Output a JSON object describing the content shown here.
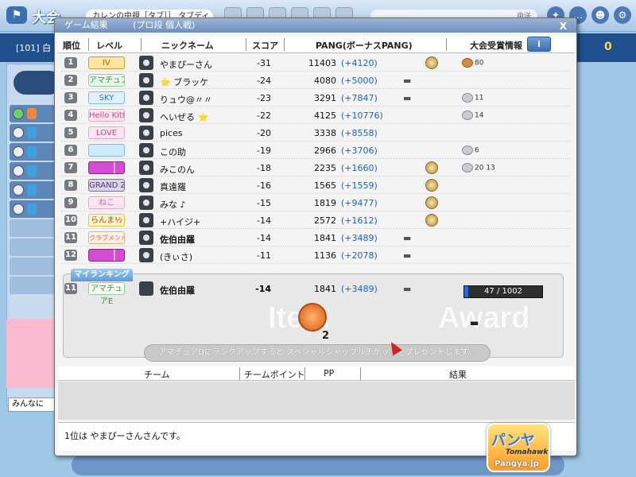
{
  "background": {
    "title": "大会",
    "room_name": "カレンの中視［タブ］］ タブディ",
    "send_label": "申送",
    "room_number": "[101] 白",
    "score": "0",
    "chat_input": "みんなに"
  },
  "dialog": {
    "title": "ゲーム結果",
    "subtitle": "(プロ段 個人戦)",
    "close": "X",
    "headers": {
      "rank": "順位",
      "level": "レベル",
      "nickname": "ニックネーム",
      "score": "スコア",
      "pang": "PANG(ボーナスPANG)",
      "tournament_info": "大会受賞情報",
      "info_button": "i"
    },
    "rows": [
      {
        "rank": "1",
        "level": "IV",
        "level_style": "pro",
        "name": "やまぴーさん",
        "score": "-31",
        "pang": "11403",
        "bonus": "(+4120)",
        "dash": "",
        "medal": true,
        "award": "80",
        "award_style": "cu",
        "bold": false
      },
      {
        "rank": "2",
        "level": "アマチュアA",
        "level_style": "am",
        "name": "⭐ ブラッケ",
        "score": "-24",
        "pang": "4080",
        "bonus": "(+5000)",
        "dash": "▬",
        "medal": false,
        "award": "",
        "award_style": "",
        "bold": false
      },
      {
        "rank": "3",
        "level": "SKY",
        "level_style": "wing",
        "name": "りュウ@〃〃",
        "score": "-23",
        "pang": "3291",
        "bonus": "(+7847)",
        "dash": "▬",
        "medal": false,
        "award": "11",
        "award_style": "",
        "bold": false
      },
      {
        "rank": "4",
        "level": "Hello Kitty",
        "level_style": "pink",
        "name": "へいぜる ⭐",
        "score": "-22",
        "pang": "4125",
        "bonus": "(+10776)",
        "dash": "",
        "medal": false,
        "award": "14",
        "award_style": "",
        "bold": false
      },
      {
        "rank": "5",
        "level": "LOVE",
        "level_style": "pink",
        "name": "pices",
        "score": "-20",
        "pang": "3338",
        "bonus": "(+8558)",
        "dash": "",
        "medal": false,
        "award": "",
        "award_style": "",
        "bold": false
      },
      {
        "rank": "6",
        "level": "",
        "level_style": "sky",
        "name": "この助",
        "score": "-19",
        "pang": "2966",
        "bonus": "(+3706)",
        "dash": "",
        "medal": false,
        "award": "6",
        "award_style": "",
        "bold": false
      },
      {
        "rank": "7",
        "level": "",
        "level_style": "bar",
        "name": "みこのん",
        "score": "-18",
        "pang": "2235",
        "bonus": "(+1660)",
        "dash": "",
        "medal": true,
        "award": "20 13",
        "award_style": "",
        "bold": false
      },
      {
        "rank": "8",
        "level": "GRAND ZODIAC",
        "level_style": "grand",
        "name": "真遠羅",
        "score": "-16",
        "pang": "1565",
        "bonus": "(+1559)",
        "dash": "",
        "medal": true,
        "award": "",
        "award_style": "",
        "bold": false
      },
      {
        "rank": "9",
        "level": "ねこ",
        "level_style": "neko",
        "name": "みな ♪",
        "score": "-15",
        "pang": "1819",
        "bonus": "(+9477)",
        "dash": "",
        "medal": true,
        "award": "",
        "award_style": "",
        "bold": false
      },
      {
        "rank": "10",
        "level": "らんま½",
        "level_style": "rin",
        "name": "+ハイジ+",
        "score": "-14",
        "pang": "2572",
        "bonus": "(+1612)",
        "dash": "",
        "medal": true,
        "award": "",
        "award_style": "",
        "bold": false
      },
      {
        "rank": "11",
        "level": "クラブメンバー募集中",
        "level_style": "club",
        "name": "佐伯由羅",
        "score": "-14",
        "pang": "1841",
        "bonus": "(+3489)",
        "dash": "▬",
        "medal": false,
        "award": "",
        "award_style": "",
        "bold": true
      },
      {
        "rank": "12",
        "level": "",
        "level_style": "bar",
        "name": "(きぃさ)",
        "score": "-11",
        "pang": "1136",
        "bonus": "(+2078)",
        "dash": "▬",
        "medal": false,
        "award": "",
        "award_style": "",
        "bold": false
      }
    ],
    "my_ranking": {
      "label": "マイランキング",
      "rank": "11",
      "level": "アマチュアE",
      "name": "佐伯由羅",
      "score": "-14",
      "pang": "1841",
      "bonus": "(+3489)",
      "dash": "▬",
      "progress_text": "47 / 1002",
      "progress_fraction": 0.047
    },
    "item_word": "Item",
    "award_word": "Award",
    "ticket_count": "2",
    "award_dash": "▬",
    "notice": "アマチュアDにランクアップすると スペシャルシャッフルチケットをプレゼントします。",
    "team_headers": {
      "team": "チーム",
      "team_point": "チームポイント",
      "pp": "PP",
      "result": "結果"
    },
    "result_message": "1位は やまぴーさんさんです。"
  },
  "logo": {
    "text": "パンヤ",
    "sub": "Tomahawk",
    "site": "Pangya.jp"
  }
}
